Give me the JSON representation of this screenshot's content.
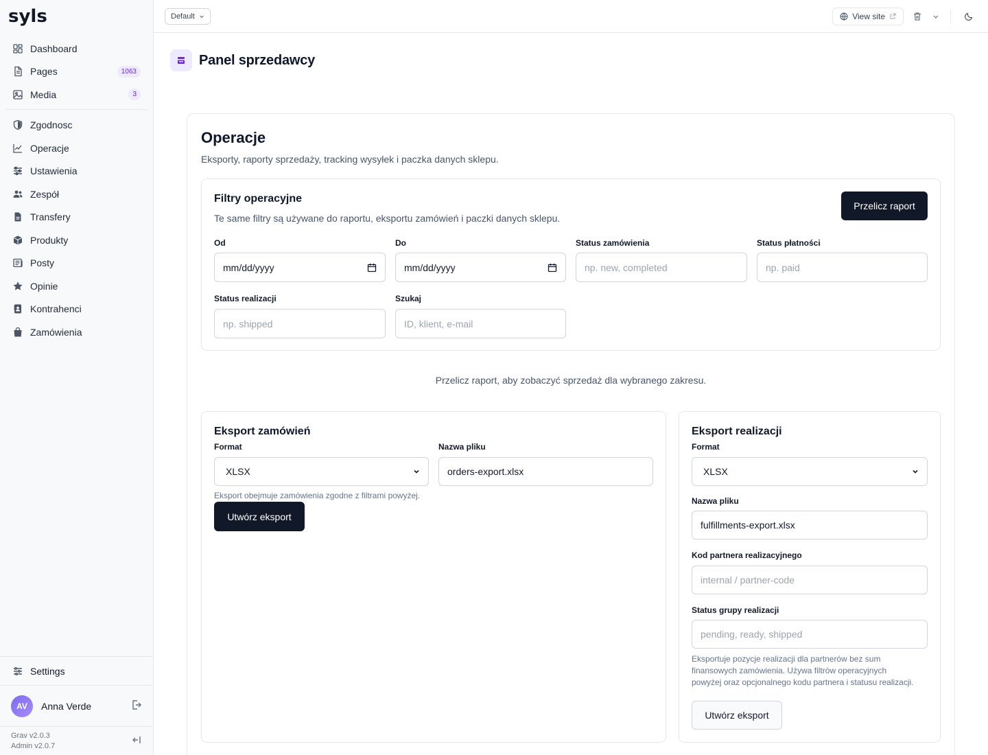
{
  "brand": {
    "logo_text": "syls"
  },
  "sidebar": {
    "primary": [
      {
        "label": "Dashboard",
        "icon": "dashboard-icon"
      },
      {
        "label": "Pages",
        "icon": "pages-icon",
        "badge": "1063"
      },
      {
        "label": "Media",
        "icon": "media-icon",
        "badge": "3"
      }
    ],
    "secondary": [
      {
        "label": "Zgodnosc",
        "icon": "shield-icon"
      },
      {
        "label": "Operacje",
        "icon": "chart-line-icon"
      },
      {
        "label": "Ustawienia",
        "icon": "sliders-icon"
      },
      {
        "label": "Zespół",
        "icon": "users-icon"
      },
      {
        "label": "Transfery",
        "icon": "file-icon"
      },
      {
        "label": "Produkty",
        "icon": "box-icon"
      },
      {
        "label": "Posty",
        "icon": "newspaper-icon"
      },
      {
        "label": "Opinie",
        "icon": "star-icon"
      },
      {
        "label": "Kontrahenci",
        "icon": "contact-icon"
      },
      {
        "label": "Zamówienia",
        "icon": "bag-icon"
      }
    ],
    "settings_label": "Settings",
    "user": {
      "initials": "AV",
      "name": "Anna Verde"
    },
    "versions": {
      "grav": "Grav v2.0.3",
      "admin": "Admin v2.0.7"
    }
  },
  "topbar": {
    "environment": "Default",
    "view_site": "View site"
  },
  "page": {
    "title": "Panel sprzedawcy"
  },
  "operations": {
    "title": "Operacje",
    "subtitle": "Eksporty, raporty sprzedaży, tracking wysyłek i paczka danych sklepu.",
    "filters": {
      "title": "Filtry operacyjne",
      "subtitle": "Te same filtry są używane do raportu, eksportu zamówień i paczki danych sklepu.",
      "recalc_button": "Przelicz raport",
      "from_label": "Od",
      "from_placeholder": "mm/dd/yyyy",
      "to_label": "Do",
      "to_placeholder": "mm/dd/yyyy",
      "order_status_label": "Status zamówienia",
      "order_status_placeholder": "np. new, completed",
      "payment_status_label": "Status płatności",
      "payment_status_placeholder": "np. paid",
      "fulfillment_status_label": "Status realizacji",
      "fulfillment_status_placeholder": "np. shipped",
      "search_label": "Szukaj",
      "search_placeholder": "ID, klient, e-mail"
    },
    "report_hint": "Przelicz raport, aby zobaczyć sprzedaż dla wybranego zakresu.",
    "orders_export": {
      "title": "Eksport zamówień",
      "format_label": "Format",
      "format_value": "XLSX",
      "filename_label": "Nazwa pliku",
      "filename_value": "orders-export.xlsx",
      "note": "Eksport obejmuje zamówienia zgodne z filtrami powyżej.",
      "button": "Utwórz eksport"
    },
    "fulfillment_export": {
      "title": "Eksport realizacji",
      "format_label": "Format",
      "format_value": "XLSX",
      "filename_label": "Nazwa pliku",
      "filename_value": "fulfillments-export.xlsx",
      "partner_label": "Kod partnera realizacyjnego",
      "partner_placeholder": "internal / partner-code",
      "group_status_label": "Status grupy realizacji",
      "group_status_placeholder": "pending, ready, shipped",
      "note": "Eksportuje pozycje realizacji dla partnerów bez sum finansowych zamówienia. Używa filtrów operacyjnych powyżej oraz opcjonalnego kodu partnera i statusu realizacji.",
      "button": "Utwórz eksport"
    }
  },
  "colors": {
    "accent": "#6d28d9",
    "dark_button": "#111827",
    "border": "#e5e7eb"
  }
}
